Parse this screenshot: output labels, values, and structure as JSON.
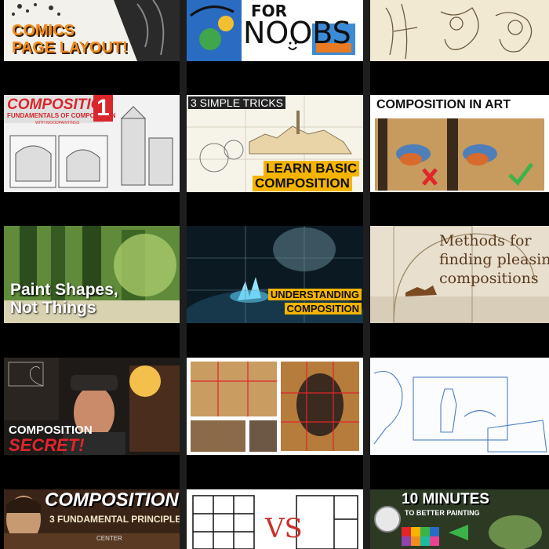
{
  "thumbnails": [
    {
      "id": "comics",
      "lines": [
        "COMICS",
        "PAGE LAYOUT!"
      ]
    },
    {
      "id": "noobs",
      "lines": [
        "FOR",
        "NOOBS"
      ]
    },
    {
      "id": "sketch-top",
      "lines": []
    },
    {
      "id": "comp1",
      "lines": [
        "COMPOSITION",
        "FUNDAMENTALS OF COMPOSITION",
        "1",
        "WITH MOODPAINTINGS"
      ]
    },
    {
      "id": "tricks",
      "lines": [
        "3 SIMPLE TRICKS",
        "LEARN BASIC",
        "COMPOSITION"
      ]
    },
    {
      "id": "comp-art",
      "lines": [
        "COMPOSITION IN ART"
      ]
    },
    {
      "id": "paint-shapes",
      "lines": [
        "Paint Shapes,",
        "Not Things"
      ]
    },
    {
      "id": "understanding",
      "lines": [
        "UNDERSTANDING",
        "COMPOSITION"
      ]
    },
    {
      "id": "methods",
      "lines": [
        "Methods for",
        "finding pleasing",
        "compositions"
      ]
    },
    {
      "id": "secret",
      "lines": [
        "COMPOSITION",
        "SECRET!"
      ]
    },
    {
      "id": "cezanne",
      "lines": []
    },
    {
      "id": "sketch-bottom",
      "lines": []
    },
    {
      "id": "fundamental",
      "lines": [
        "COMPOSITION",
        "3 FUNDAMENTAL PRINCIPLES",
        "CENTER"
      ]
    },
    {
      "id": "grid-vs",
      "lines": [
        "VS"
      ]
    },
    {
      "id": "ten-min",
      "lines": [
        "10 MINUTES",
        "TO BETTER PAINTING"
      ]
    }
  ],
  "colors": {
    "background": "#000000",
    "gap": "#1e1e1e",
    "orange": "#f08c1e",
    "yellow": "#f5b400",
    "red": "#e0262b",
    "green": "#3bb34a"
  }
}
